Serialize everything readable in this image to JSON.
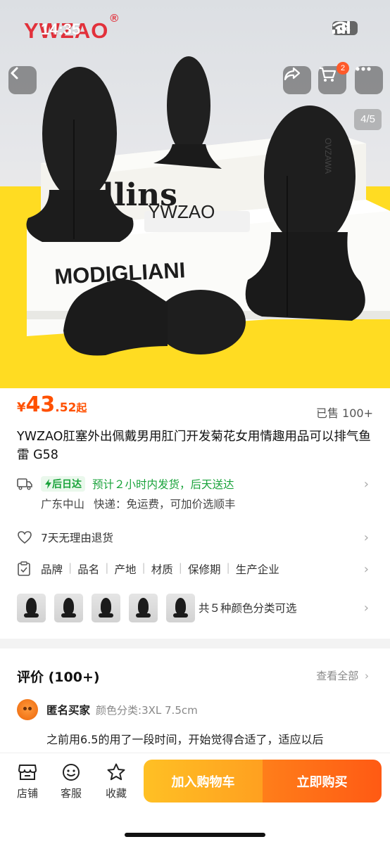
{
  "status_bar": {
    "time": "14:35",
    "battery": "34"
  },
  "hero": {
    "brand_logo": "YWZAO",
    "brand_reg": "®",
    "page_indicator": "4/5",
    "cart_badge": "2",
    "book_text_1": "llins",
    "book_text_2": "MODIGLIANI",
    "stand_text": "YWZAO",
    "product_engraving": "OVZAWA"
  },
  "product": {
    "price_currency": "¥",
    "price_integer": "43",
    "price_decimal": ".52",
    "price_suffix": "起",
    "sold_count": "已售 100+",
    "title": "YWZAO肛塞外出佩戴男用肛门开发菊花女用情趣用品可以排气鱼雷 G58"
  },
  "shipping": {
    "badge": "后日达",
    "eta": "预计２小时内发货，后天送达",
    "origin": "广东中山",
    "express": "快递：免运费，可加价选顺丰"
  },
  "return_policy": "7天无理由退货",
  "attributes": [
    "品牌",
    "品名",
    "产地",
    "材质",
    "保修期",
    "生产企业"
  ],
  "variants": {
    "summary": "共５种颜色分类可选",
    "count": 5
  },
  "reviews": {
    "title": "评价 (100+)",
    "view_all": "查看全部",
    "reviewer_name": "匿名买家",
    "reviewer_spec": "颜色分类:3XL 7.5cm",
    "text": "之前用6.5的用了一段时间，开始觉得合适了，适应以后"
  },
  "bottom_bar": {
    "store": "店铺",
    "service": "客服",
    "favorite": "收藏",
    "add_to_cart": "加入购物车",
    "buy_now": "立即购买"
  },
  "colors": {
    "accent": "#ff5000",
    "green": "#1aa33b",
    "cart_button": "#ffb020",
    "buy_button": "#ff6a16"
  }
}
